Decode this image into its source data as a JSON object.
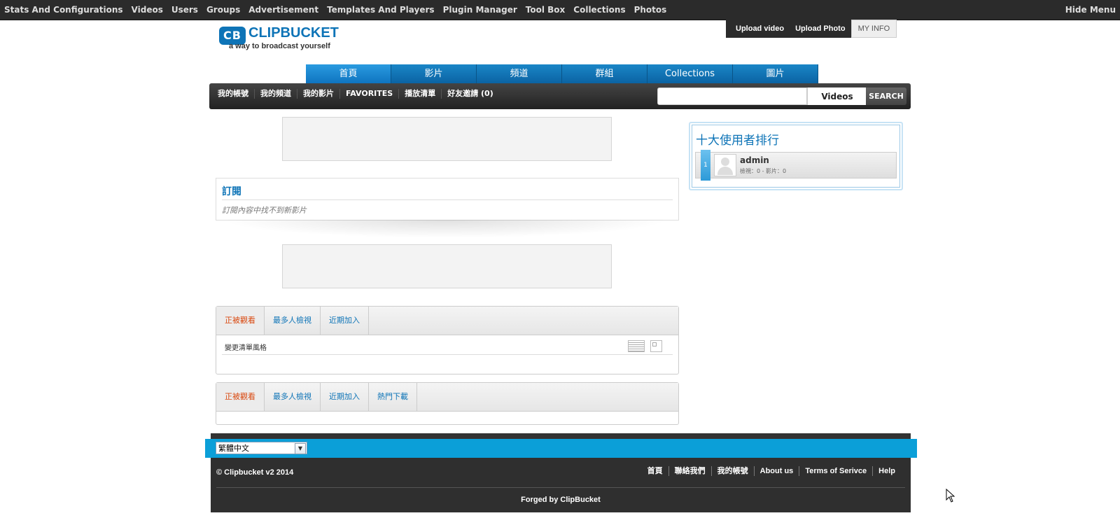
{
  "adminbar": {
    "items": [
      "Stats And Configurations",
      "Videos",
      "Users",
      "Groups",
      "Advertisement",
      "Templates And Players",
      "Plugin Manager",
      "Tool Box",
      "Collections",
      "Photos"
    ],
    "hide_label": "Hide Menu"
  },
  "logo": {
    "mark": "CB",
    "name": "CLIPBUCKET",
    "tagline": "a way to broadcast yourself"
  },
  "user_buttons": {
    "upload_video": "Upload video",
    "upload_photo": "Upload Photo",
    "my_info": "MY INFO"
  },
  "main_nav": [
    "首頁",
    "影片",
    "頻道",
    "群組",
    "Collections",
    "圖片"
  ],
  "sub_nav": [
    "我的帳號",
    "我的頻道",
    "我的影片",
    "FAVORITES",
    "播放清單",
    "好友邀請 (0)"
  ],
  "search": {
    "placeholder": "",
    "type": "Videos",
    "button": "SEARCH"
  },
  "subscriptions": {
    "title": "訂閱",
    "message": "訂閱內容中找不到新影片"
  },
  "video_box": {
    "tabs": [
      "正被觀看",
      "最多人檢視",
      "近期加入"
    ],
    "list_label": "變更清單風格"
  },
  "video_box2": {
    "tabs": [
      "正被觀看",
      "最多人檢視",
      "近期加入",
      "熱門下載"
    ]
  },
  "top_users": {
    "title": "十大使用者排行",
    "users": [
      {
        "rank": "1",
        "name": "admin",
        "stats": "檢視：0 - 影片：0"
      }
    ]
  },
  "footer": {
    "language": "繁體中文",
    "copyright": "© Clipbucket v2 2014",
    "links": [
      "首頁",
      "聯絡我們",
      "我的帳號",
      "About us",
      "Terms of Serivce",
      "Help"
    ],
    "forged": "Forged by ClipBucket"
  },
  "colors": {
    "brand_blue": "#0e74b7",
    "active_tab": "#d9480f",
    "footer_blue": "#0b9fd8"
  }
}
